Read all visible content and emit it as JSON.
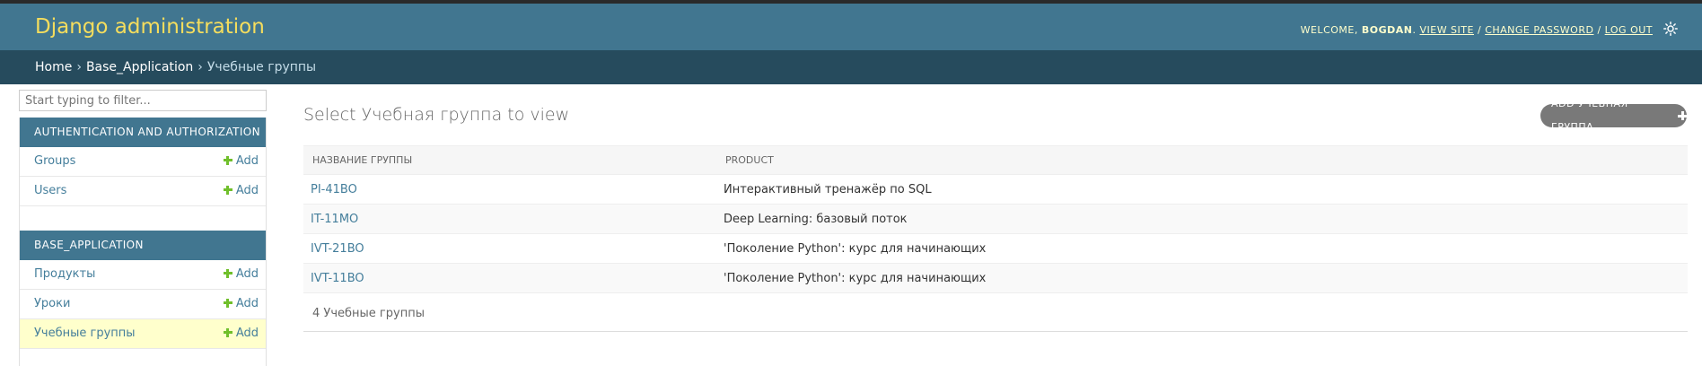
{
  "header": {
    "site_name": "Django administration",
    "welcome": "Welcome,",
    "username": "bogdan",
    "view_site": "View site",
    "change_password": "Change password",
    "log_out": "Log out",
    "theme_toggle_icon": "sun-icon"
  },
  "breadcrumbs": {
    "home": "Home",
    "app": "Base_Application",
    "current": "Учебные группы",
    "separator": "›"
  },
  "sidebar": {
    "filter_placeholder": "Start typing to filter...",
    "apps": [
      {
        "caption": "Authentication and Authorization",
        "models": [
          {
            "label": "Groups",
            "add": "Add"
          },
          {
            "label": "Users",
            "add": "Add"
          }
        ]
      },
      {
        "caption": "Base_Application",
        "models": [
          {
            "label": "Продукты",
            "add": "Add"
          },
          {
            "label": "Уроки",
            "add": "Add"
          },
          {
            "label": "Учебные группы",
            "add": "Add",
            "current": true
          }
        ]
      }
    ]
  },
  "content": {
    "title": "Select Учебная группа to view",
    "add_button": "Add Учебная группа",
    "columns": [
      "Название группы",
      "Product"
    ],
    "rows": [
      {
        "name": "PI-41BO",
        "product": "Интерактивный тренажёр по SQL"
      },
      {
        "name": "IT-11MO",
        "product": "Deep Learning: базовый поток"
      },
      {
        "name": "IVT-21BO",
        "product": "'Поколение Python': курс для начинающих"
      },
      {
        "name": "IVT-11BO",
        "product": "'Поколение Python': курс для начинающих"
      }
    ],
    "paginator": "4 Учебные группы"
  },
  "colors": {
    "header": "#417690",
    "breadcrumbs": "#264b5d",
    "branding": "#f5dd5d",
    "link": "#447e9b",
    "add_plus": "#70bf2b",
    "current_row": "#ffffcc"
  }
}
